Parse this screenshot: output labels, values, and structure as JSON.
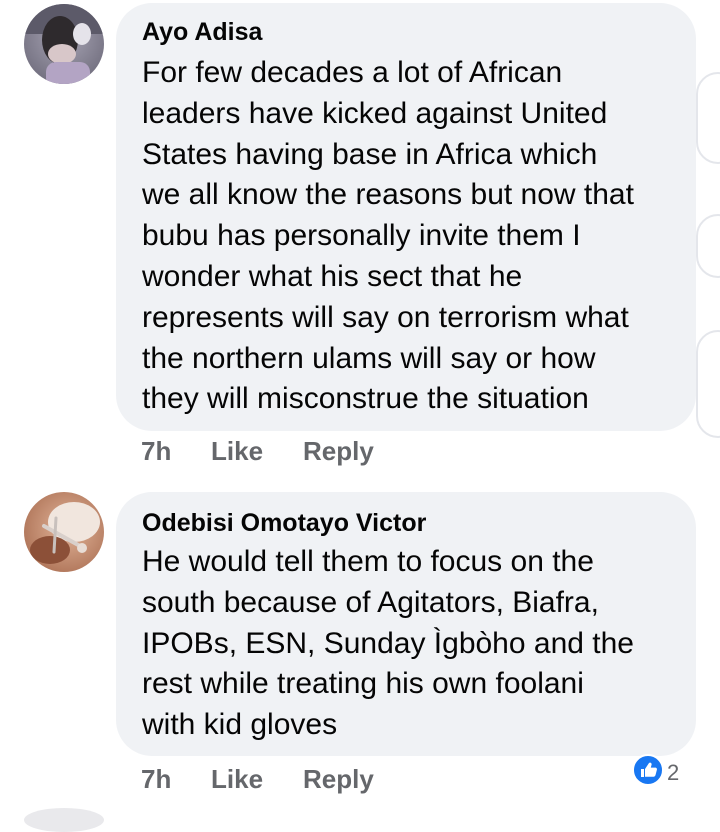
{
  "comments": [
    {
      "author": "Ayo Adisa",
      "lines": [
        "For few decades a lot of African",
        "leaders have kicked against United",
        "States having base in Africa which",
        "we all know the reasons but now that",
        "bubu has personally invite them I",
        "wonder what his sect that he",
        "represents will say on terrorism what",
        "the northern ulams will say or how",
        "they will misconstrue the situation"
      ],
      "time": "7h",
      "like_label": "Like",
      "reply_label": "Reply"
    },
    {
      "author": "Odebisi Omotayo Victor",
      "lines": [
        "He would tell them to focus on the",
        "south because of Agitators, Biafra,",
        "IPOBs, ESN, Sunday Ìgbòho and the",
        "rest while treating his own foolani",
        "with kid gloves"
      ],
      "time": "7h",
      "like_label": "Like",
      "reply_label": "Reply",
      "reaction": {
        "icon": "like-reaction-icon",
        "count": "2",
        "color": "#1877f2"
      }
    }
  ]
}
